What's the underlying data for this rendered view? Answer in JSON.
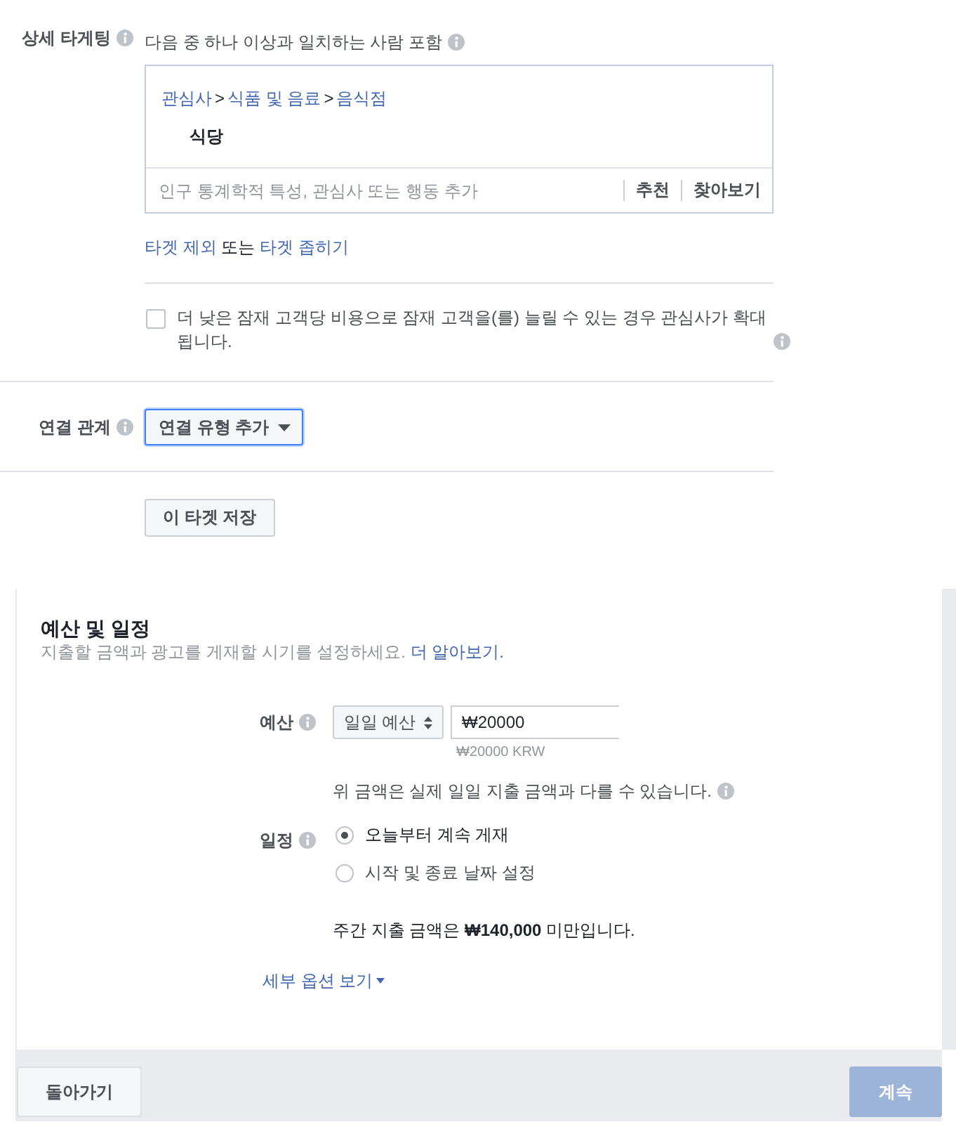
{
  "detailed_targeting": {
    "label": "상세 타게팅",
    "include_label": "다음 중 하나 이상과 일치하는 사람 포함",
    "path": [
      {
        "text": "관심사",
        "kind": "link"
      },
      {
        "text": ">",
        "kind": "separator"
      },
      {
        "text": "식품 및 음료",
        "kind": "link"
      },
      {
        "text": ">",
        "kind": "separator"
      },
      {
        "text": "음식점",
        "kind": "link"
      }
    ],
    "selected_item": "식당",
    "search": {
      "placeholder": "인구 통계학적 특성, 관심사 또는 행동 추가",
      "actions": [
        "추천",
        "찾아보기"
      ]
    },
    "options_line": [
      {
        "text": "타겟 제외",
        "kind": "link"
      },
      {
        "text": "또는",
        "kind": "text"
      },
      {
        "text": "타겟 좁히기",
        "kind": "link"
      }
    ],
    "expansion": {
      "checked": false,
      "text": "더 낮은 잠재 고객당 비용으로 잠재 고객을(를) 늘릴 수 있는 경우 관심사가 확대됩니다."
    }
  },
  "connections": {
    "label": "연결 관계",
    "button": "연결 유형 추가"
  },
  "save_button": "이 타겟 저장",
  "budget_schedule": {
    "title": "예산 및 일정",
    "subtitle": "지출할 금액과 광고를 게재할 시기를 설정하세요.",
    "learn_more": "더 알아보기.",
    "budget": {
      "label": "예산",
      "type": "일일 예산",
      "value": "₩20000",
      "converted": "₩20000 KRW",
      "note": "위 금액은 실제 일일 지출 금액과 다를 수 있습니다."
    },
    "schedule": {
      "label": "일정",
      "options": [
        {
          "label": "오늘부터 계속 게재",
          "selected": true
        },
        {
          "label": "시작 및 종료 날짜 설정",
          "selected": false
        }
      ]
    },
    "weekly_note": "주간 지출 금액은 **₩140,000** 미만입니다.",
    "more_options": "세부 옵션 보기"
  },
  "footer": {
    "back": "돌아가기",
    "continue": {
      "label": "계속",
      "disabled": true
    }
  }
}
